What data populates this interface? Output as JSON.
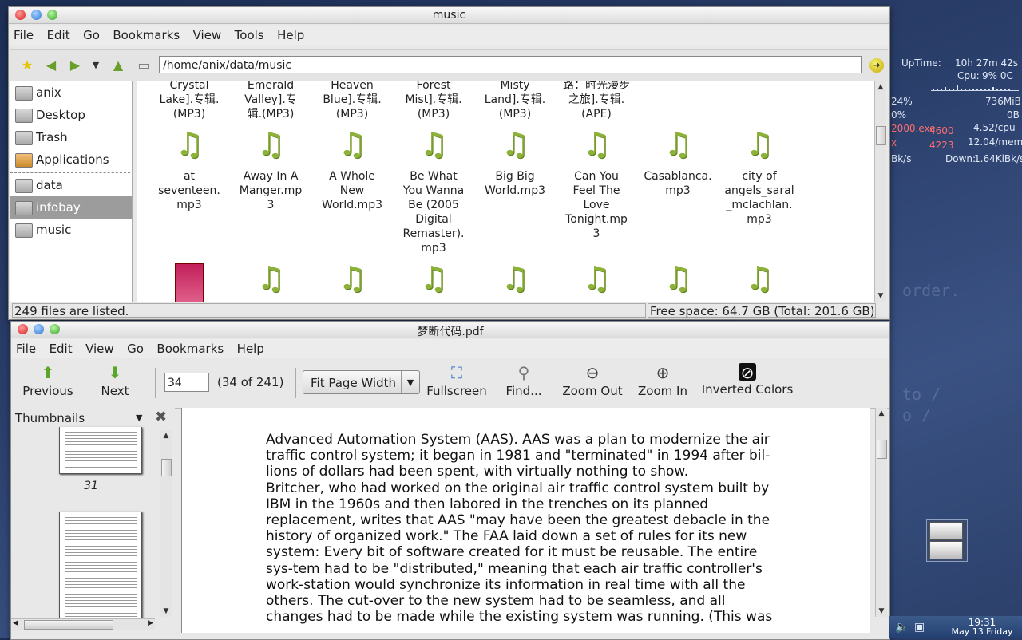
{
  "desktop": {
    "bg_words": [
      "order.",
      "to /",
      "o /"
    ]
  },
  "conky": {
    "uptime_label": "UpTime:",
    "uptime_value": "10h 27m 42s",
    "cpu_label": "Cpu:",
    "cpu_value": "9% 0C",
    "mem_pct": "24%",
    "mem_value": "736MiB",
    "swap_pct": "0%",
    "swap_value": "0B",
    "proc1": "2000.exe",
    "proc1_pid": "4600",
    "proc1_stat": "4.52/cpu",
    "proc2": "x",
    "proc2_pid": "4223",
    "proc2_stat": "12.04/mem",
    "net_up": "Bk/s",
    "net_down_label": "Down:",
    "net_down_value": "1.64KiBk/s",
    "cpu_graph": [
      0.1,
      0.2,
      0.1,
      0.3,
      0.15,
      0.1,
      0.5,
      0.1,
      0.2,
      0.1,
      0.15,
      0.1,
      0.2,
      0.1,
      0.1,
      0.3,
      0.1,
      0.1,
      0.2,
      0.1
    ]
  },
  "file_manager": {
    "title": "music",
    "menu": [
      "File",
      "Edit",
      "Go",
      "Bookmarks",
      "View",
      "Tools",
      "Help"
    ],
    "path": "/home/anix/data/music",
    "sidebar": [
      {
        "label": "anix",
        "icon": "home-icon",
        "selected": false
      },
      {
        "label": "Desktop",
        "icon": "desktop-icon",
        "selected": false
      },
      {
        "label": "Trash",
        "icon": "trash-icon",
        "selected": false
      },
      {
        "label": "Applications",
        "icon": "applications-icon",
        "selected": false
      },
      {
        "label": "data",
        "icon": "folder-icon",
        "selected": false
      },
      {
        "label": "infobay",
        "icon": "folder-icon",
        "selected": true
      },
      {
        "label": "music",
        "icon": "folder-icon",
        "selected": false
      }
    ],
    "top_row_names": [
      "Crystal\nLake].专辑.\n(MP3)",
      "Emerald\nValley].专\n辑.(MP3)",
      "Heaven\nBlue].专辑.\n(MP3)",
      "Forest\nMist].专辑.\n(MP3)",
      "Misty\nLand].专辑.\n(MP3)",
      "路：时光漫步\n之旅].专辑.\n(APE)"
    ],
    "files": [
      "at\nseventeen.\nmp3",
      "Away In A\nManger.mp\n3",
      "A Whole\nNew\nWorld.mp3",
      "Be What\nYou Wanna\nBe (2005\nDigital\nRemaster).\nmp3",
      "Big Big\nWorld.mp3",
      "Can You\nFeel The\nLove\nTonight.mp\n3",
      "Casablanca.\nmp3",
      "city of\nangels_saral\n_mclachlan.\nmp3"
    ],
    "status_left": "249 files are listed.",
    "status_right": "Free space: 64.7 GB (Total: 201.6 GB)"
  },
  "pdf_viewer": {
    "title": "梦断代码.pdf",
    "menu": [
      "File",
      "Edit",
      "View",
      "Go",
      "Bookmarks",
      "Help"
    ],
    "previous_label": "Previous",
    "next_label": "Next",
    "page_input": "34",
    "page_total": "(34 of 241)",
    "zoom_value": "Fit Page Width",
    "fullscreen_label": "Fullscreen",
    "find_label": "Find...",
    "zoom_out_label": "Zoom Out",
    "zoom_in_label": "Zoom In",
    "inverted_label": "Inverted Colors",
    "sidebar_title": "Thumbnails",
    "thumb_page_label": "31",
    "text_lines": [
      "Advanced Automation System (AAS). AAS was a plan to modernize the air",
      "traffic control system; it began in 1981 and \"terminated\" in 1994 after bil-",
      "lions of dollars had been spent, with virtually nothing to show.",
      "Britcher, who had worked on the original air traffic control system built by",
      "IBM in the 1960s and then labored in the trenches on its planned",
      "replacement, writes that AAS \"may have been the greatest debacle in the",
      "history of organized work.\" The FAA laid down a set of rules for its new",
      "system: Every bit of software created for it must be reusable. The entire",
      "sys-tem had to be \"distributed,\" meaning that each air traffic controller's",
      "work-station would synchronize its information in real time with all the",
      "others. The cut-over to the new system had to be seamless, and all",
      "changes had to be made while the existing system was running. (This was"
    ]
  },
  "clock": {
    "time": "19:31",
    "date": "May 13 Friday"
  }
}
